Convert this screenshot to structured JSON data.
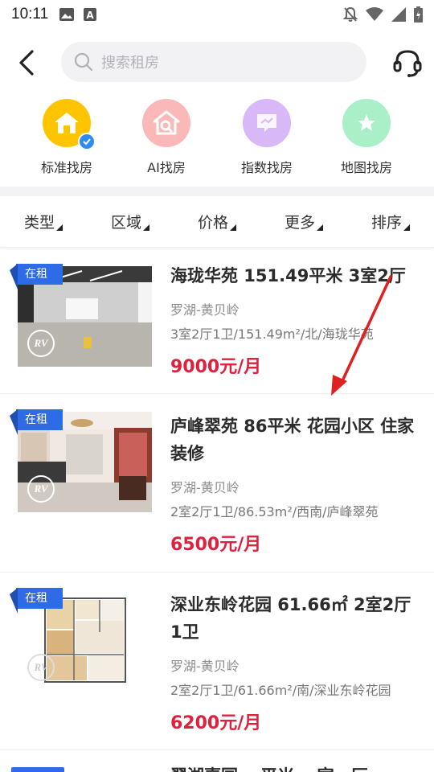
{
  "status_bar": {
    "time": "10:11",
    "left_icons": [
      "image-icon",
      "a-icon"
    ],
    "right_icons": [
      "mute-icon",
      "wifi-icon",
      "signal-icon",
      "battery-icon"
    ]
  },
  "header": {
    "back_icon": "back-arrow-icon",
    "search_placeholder": "搜索租房",
    "service_icon": "headset-icon"
  },
  "modes": [
    {
      "label": "标准找房",
      "icon": "house-icon",
      "color": "#ffc400",
      "selected": true
    },
    {
      "label": "AI找房",
      "icon": "ai-search-house-icon",
      "color": "#fbb8b8",
      "selected": false
    },
    {
      "label": "指数找房",
      "icon": "index-chat-icon",
      "color": "#d9b8f7",
      "selected": false
    },
    {
      "label": "地图找房",
      "icon": "map-pin-icon",
      "color": "#a9efc8",
      "selected": false
    }
  ],
  "filters": [
    "类型",
    "区域",
    "价格",
    "更多",
    "排序"
  ],
  "listings": [
    {
      "tag": "在租",
      "title": "海珑华苑 151.49平米 3室2厅",
      "area": "罗湖-黄贝岭",
      "detail": "3室2厅1卫/151.49m²/北/海珑华苑",
      "price": "9000元/月",
      "vr": "RV"
    },
    {
      "tag": "在租",
      "title": "庐峰翠苑 86平米 花园小区 住家装修",
      "area": "罗湖-黄贝岭",
      "detail": "2室2厅1卫/86.53m²/西南/庐峰翠苑",
      "price": "6500元/月",
      "vr": "RV"
    },
    {
      "tag": "在租",
      "title": "深业东岭花园 61.66㎡ 2室2厅1卫",
      "area": "罗湖-黄贝岭",
      "detail": "2室2厅1卫/61.66m²/南/深业东岭花园",
      "price": "6200元/月",
      "vr": "RV"
    },
    {
      "title": "翠湖嘉园 …平米 …室…厅"
    }
  ],
  "colors": {
    "accent_blue": "#2d8cf0",
    "price_red": "#e0203c",
    "tag_blue": "#2e6be6",
    "annotation_red": "#e02020"
  }
}
